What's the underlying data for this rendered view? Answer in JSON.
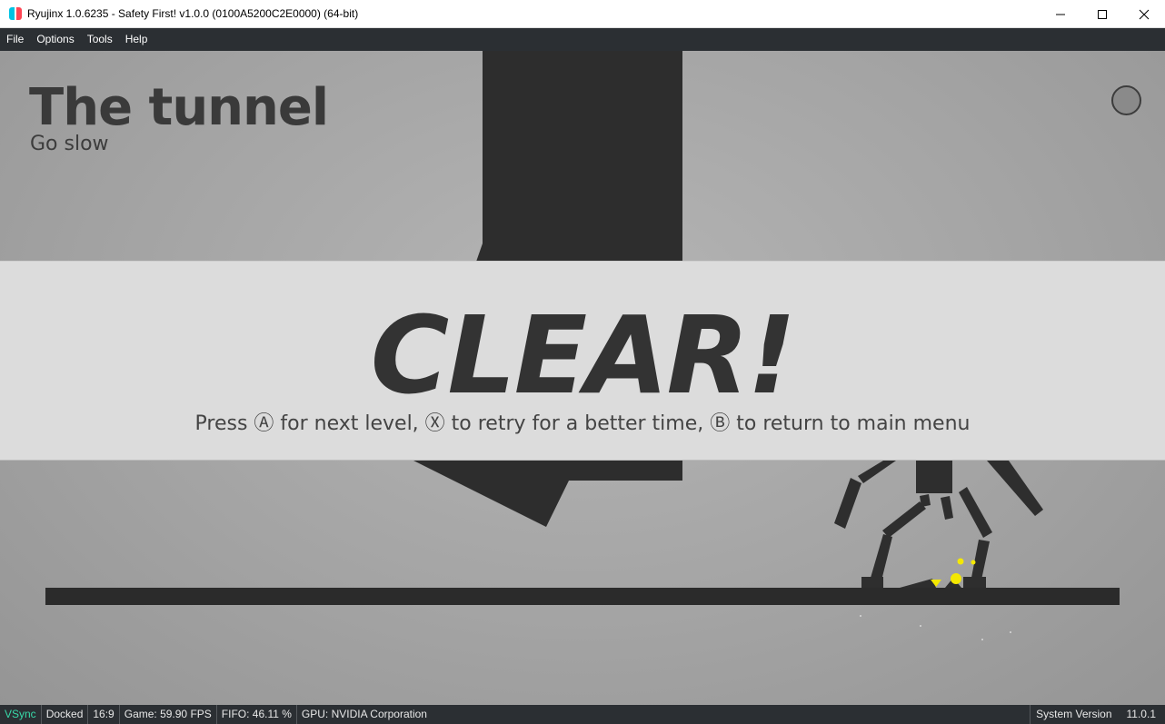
{
  "window": {
    "title": "Ryujinx 1.0.6235 - Safety First! v1.0.0 (0100A5200C2E0000) (64-bit)"
  },
  "menu": [
    "File",
    "Options",
    "Tools",
    "Help"
  ],
  "game": {
    "level_title": "The tunnel",
    "level_subtitle": "Go slow",
    "clear_title": "CLEAR!",
    "clear_instructions": "Press Ⓐ for next level, Ⓧ to retry for a better time, Ⓑ to return to main menu"
  },
  "status": {
    "vsync": "VSync",
    "dock": "Docked",
    "aspect": "16:9",
    "fps": "Game: 59.90 FPS",
    "fifo": "FIFO: 46.11 %",
    "gpu": "GPU:  NVIDIA Corporation",
    "system_version_label": "System Version",
    "system_version": "11.0.1"
  },
  "colors": {
    "titlebar": "#ffffff",
    "menubar": "#2b2f33",
    "vsync_on": "#38d9a9",
    "banner": "#dcdcdc",
    "ink": "#2d2d2d",
    "spark": "#f4e800"
  }
}
